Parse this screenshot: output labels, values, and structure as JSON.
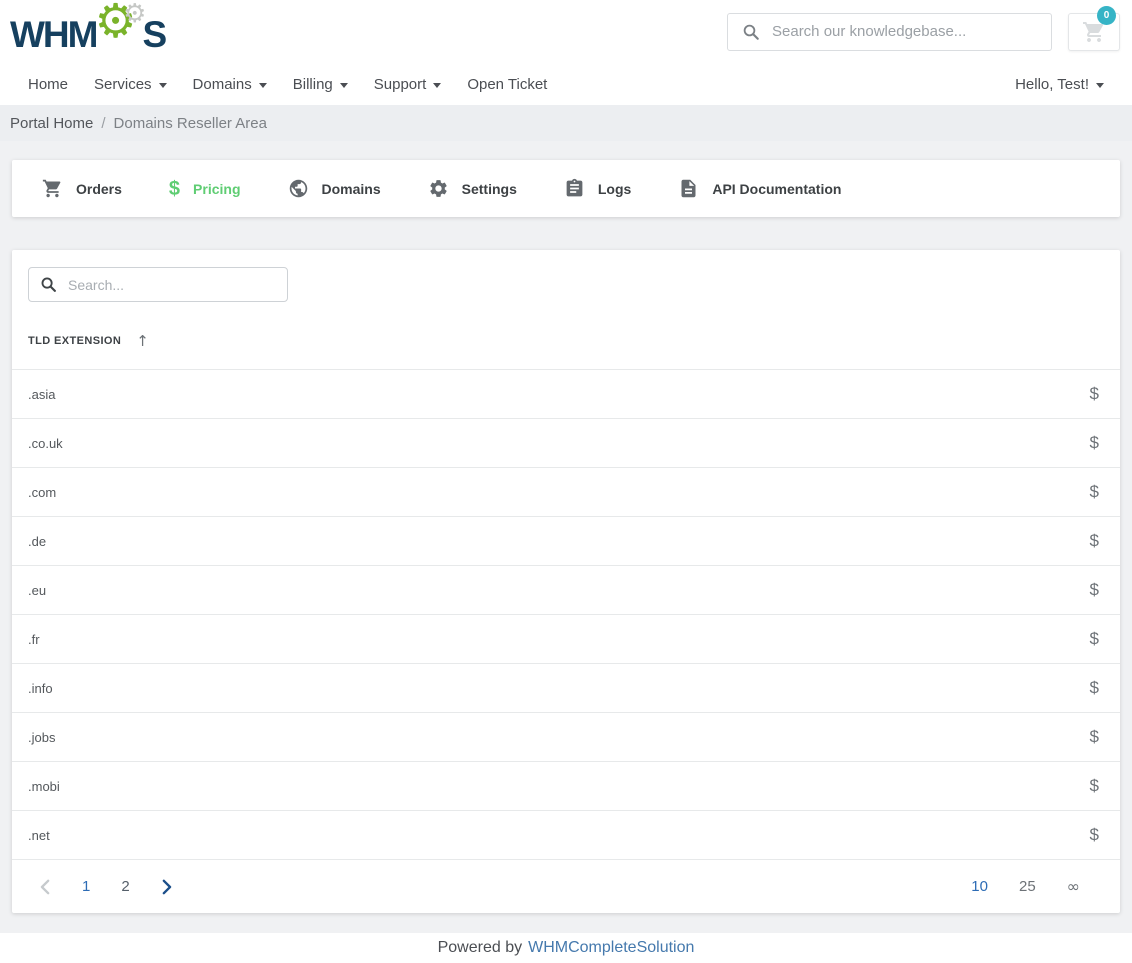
{
  "colors": {
    "accent_green": "#5fcd73",
    "badge_teal": "#36b4c6",
    "logo_navy": "#16405f",
    "logo_green": "#7ab32a",
    "link_blue": "#4579ad",
    "pagination_blue": "#2d6cb5"
  },
  "icons": {
    "dollar_glyph": "$",
    "gear_glyph": "⚙",
    "sort_up_arrow": "↑"
  },
  "header": {
    "logo_prefix": "WHM",
    "logo_suffix": "S",
    "search_placeholder": "Search our knowledgebase...",
    "cart_badge": "0"
  },
  "nav": {
    "items": [
      {
        "label": "Home"
      },
      {
        "label": "Services"
      },
      {
        "label": "Domains"
      },
      {
        "label": "Billing"
      },
      {
        "label": "Support"
      },
      {
        "label": "Open Ticket"
      }
    ],
    "user_menu_label": "Hello, Test!"
  },
  "breadcrumb": {
    "home": "Portal Home",
    "separator": "/",
    "current": "Domains Reseller Area"
  },
  "tabs": [
    {
      "label": "Orders"
    },
    {
      "label": "Pricing",
      "active": true
    },
    {
      "label": "Domains"
    },
    {
      "label": "Settings"
    },
    {
      "label": "Logs"
    },
    {
      "label": "API Documentation"
    }
  ],
  "table": {
    "search_placeholder": "Search...",
    "column_header": "TLD EXTENSION",
    "sort_direction": "ascending",
    "rows": [
      ".asia",
      ".co.uk",
      ".com",
      ".de",
      ".eu",
      ".fr",
      ".info",
      ".jobs",
      ".mobi",
      ".net"
    ]
  },
  "pagination": {
    "pages": [
      "1",
      "2"
    ],
    "current_page": "1",
    "page_sizes": [
      "10",
      "25",
      "∞"
    ],
    "current_page_size": "10"
  },
  "footer": {
    "prefix": "Powered by",
    "link": "WHMCompleteSolution"
  }
}
